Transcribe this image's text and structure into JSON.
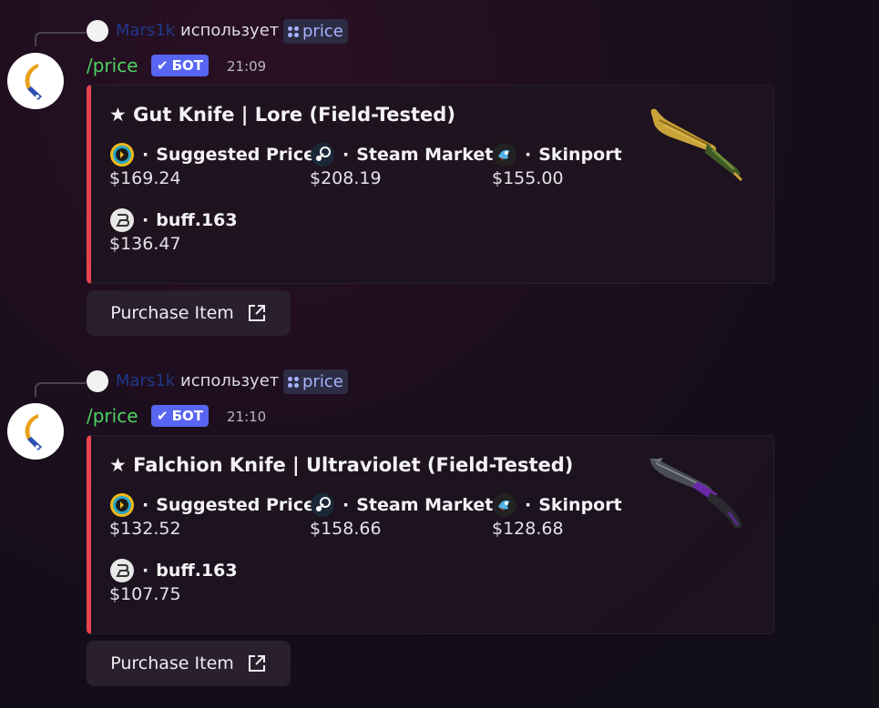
{
  "messages": [
    {
      "reply": {
        "user": "Mars1k",
        "uses_text": "использует",
        "command": "price"
      },
      "bot": {
        "name": "/price",
        "tag": "БОТ",
        "time": "21:09"
      },
      "embed": {
        "title": "★ Gut Knife | Lore (Field-Tested)",
        "accent_color": "#e64550",
        "fields": [
          {
            "icon": "suggested-price-icon",
            "label": "Suggested Price",
            "value": "$169.24"
          },
          {
            "icon": "steam-icon",
            "label": "Steam Market",
            "value": "$208.19"
          },
          {
            "icon": "skinport-icon",
            "label": "Skinport",
            "value": "$155.00"
          },
          {
            "icon": "buff-icon",
            "label": "buff.163",
            "value": "$136.47"
          }
        ]
      },
      "button": {
        "label": "Purchase Item",
        "icon": "external-link-icon"
      }
    },
    {
      "reply": {
        "user": "Mars1k",
        "uses_text": "использует",
        "command": "price"
      },
      "bot": {
        "name": "/price",
        "tag": "БОТ",
        "time": "21:10"
      },
      "embed": {
        "title": "★ Falchion Knife | Ultraviolet (Field-Tested)",
        "accent_color": "#e64550",
        "fields": [
          {
            "icon": "suggested-price-icon",
            "label": "Suggested Price",
            "value": "$132.52"
          },
          {
            "icon": "steam-icon",
            "label": "Steam Market",
            "value": "$158.66"
          },
          {
            "icon": "skinport-icon",
            "label": "Skinport",
            "value": "$128.68"
          },
          {
            "icon": "buff-icon",
            "label": "buff.163",
            "value": "$107.75"
          }
        ]
      },
      "button": {
        "label": "Purchase Item",
        "icon": "external-link-icon"
      }
    }
  ],
  "colors": {
    "bot_name": "#4ed361",
    "bot_tag": "#5865f2",
    "reply_user": "#21398a",
    "command_chip_text": "#a6b4ff"
  },
  "field_separator": "·"
}
